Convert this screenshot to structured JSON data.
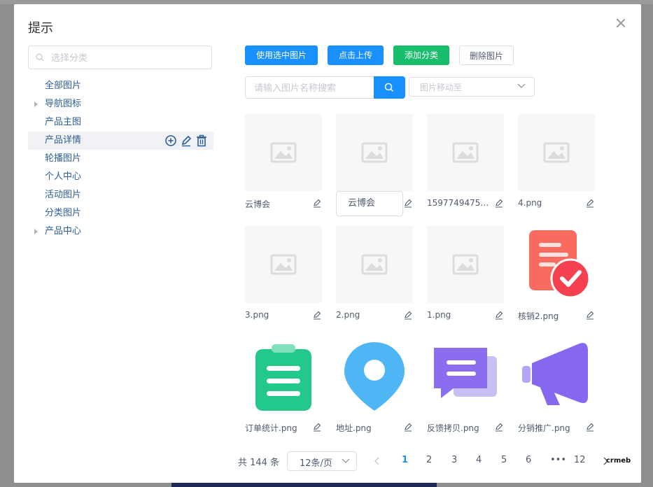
{
  "dialog": {
    "title": "提示"
  },
  "tree": {
    "search_placeholder": "选择分类",
    "nodes": [
      {
        "label": "全部图片",
        "arrow": false
      },
      {
        "label": "导航图标",
        "arrow": true
      },
      {
        "label": "产品主图",
        "arrow": false
      },
      {
        "label": "产品详情",
        "arrow": false,
        "selected": true
      },
      {
        "label": "轮播图片",
        "arrow": false
      },
      {
        "label": "个人中心",
        "arrow": false
      },
      {
        "label": "活动图片",
        "arrow": false
      },
      {
        "label": "分类图片",
        "arrow": false
      },
      {
        "label": "产品中心",
        "arrow": true
      }
    ]
  },
  "toolbar": {
    "use_selected": "使用选中图片",
    "upload": "点击上传",
    "add_category": "添加分类",
    "delete_image": "删除图片",
    "name_search_placeholder": "请输入图片名称搜索",
    "move_to_placeholder": "图片移动至"
  },
  "images": [
    {
      "name": "云博会",
      "icon": "image-placeholder-icon"
    },
    {
      "name": "",
      "icon": "image-placeholder-icon"
    },
    {
      "name": "15977494759...",
      "icon": "image-placeholder-icon"
    },
    {
      "name": "4.png",
      "icon": "image-placeholder-icon"
    },
    {
      "name": "3.png",
      "icon": "image-placeholder-icon"
    },
    {
      "name": "2.png",
      "icon": "image-placeholder-icon"
    },
    {
      "name": "1.png",
      "icon": "image-placeholder-icon"
    },
    {
      "name": "核销2.png",
      "icon": "verify-document-icon"
    },
    {
      "name": "订单统计.png",
      "icon": "clipboard-icon"
    },
    {
      "name": "地址.png",
      "icon": "location-pin-icon"
    },
    {
      "name": "反馈拷贝.png",
      "icon": "chat-bubble-icon"
    },
    {
      "name": "分销推广.png",
      "icon": "megaphone-icon"
    }
  ],
  "tooltip": {
    "text": "云博会"
  },
  "pagination": {
    "total": "共 144 条",
    "page_size": "12条/页",
    "pages": [
      "1",
      "2",
      "3",
      "4",
      "5",
      "6",
      "•••",
      "12"
    ],
    "current": "1"
  },
  "watermark": "crmeb",
  "colors": {
    "primary": "#1890ff",
    "success": "#19be6b",
    "link": "#2d5e97"
  }
}
